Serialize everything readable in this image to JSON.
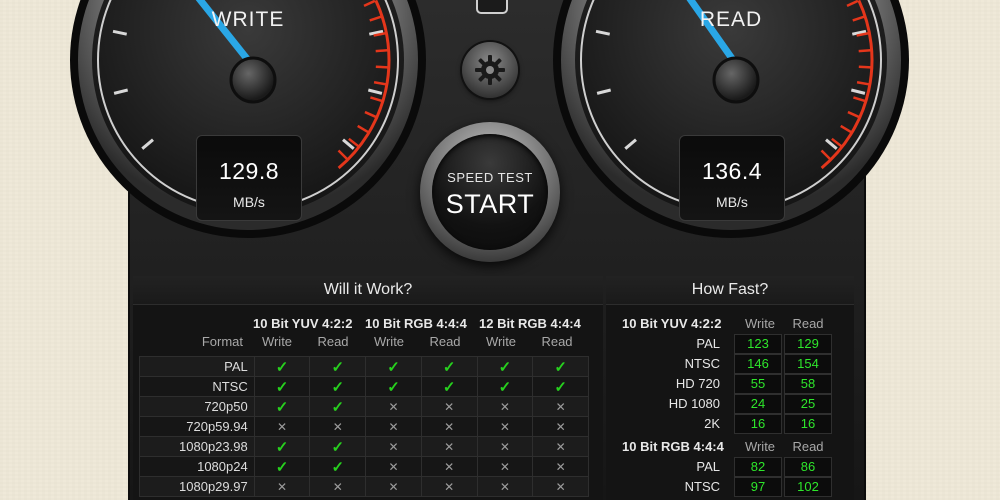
{
  "write_gauge": {
    "label": "WRITE",
    "value": "129.8",
    "unit": "MB/s"
  },
  "read_gauge": {
    "label": "READ",
    "value": "136.4",
    "unit": "MB/s"
  },
  "start_button": {
    "sub_label": "SPEED TEST",
    "label": "START"
  },
  "will_it_work": {
    "title": "Will it Work?",
    "format_header": "Format",
    "groups": [
      {
        "name": "10 Bit YUV 4:2:2",
        "write": "Write",
        "read": "Read"
      },
      {
        "name": "10 Bit RGB 4:4:4",
        "write": "Write",
        "read": "Read"
      },
      {
        "name": "12 Bit RGB 4:4:4",
        "write": "Write",
        "read": "Read"
      }
    ],
    "rows": [
      {
        "format": "PAL",
        "cells": [
          "✓",
          "✓",
          "✓",
          "✓",
          "✓",
          "✓"
        ]
      },
      {
        "format": "NTSC",
        "cells": [
          "✓",
          "✓",
          "✓",
          "✓",
          "✓",
          "✓"
        ]
      },
      {
        "format": "720p50",
        "cells": [
          "✓",
          "✓",
          "✕",
          "✕",
          "✕",
          "✕"
        ]
      },
      {
        "format": "720p59.94",
        "cells": [
          "✕",
          "✕",
          "✕",
          "✕",
          "✕",
          "✕"
        ]
      },
      {
        "format": "1080p23.98",
        "cells": [
          "✓",
          "✓",
          "✕",
          "✕",
          "✕",
          "✕"
        ]
      },
      {
        "format": "1080p24",
        "cells": [
          "✓",
          "✓",
          "✕",
          "✕",
          "✕",
          "✕"
        ]
      },
      {
        "format": "1080p29.97",
        "cells": [
          "✕",
          "✕",
          "✕",
          "✕",
          "✕",
          "✕"
        ]
      }
    ]
  },
  "how_fast": {
    "title": "How Fast?",
    "sections": [
      {
        "name": "10 Bit YUV 4:2:2",
        "write": "Write",
        "read": "Read",
        "rows": [
          {
            "label": "PAL",
            "write": "123",
            "read": "129"
          },
          {
            "label": "NTSC",
            "write": "146",
            "read": "154"
          },
          {
            "label": "HD 720",
            "write": "55",
            "read": "58"
          },
          {
            "label": "HD 1080",
            "write": "24",
            "read": "25"
          },
          {
            "label": "2K",
            "write": "16",
            "read": "16"
          }
        ]
      },
      {
        "name": "10 Bit RGB 4:4:4",
        "write": "Write",
        "read": "Read",
        "rows": [
          {
            "label": "PAL",
            "write": "82",
            "read": "86"
          },
          {
            "label": "NTSC",
            "write": "97",
            "read": "102"
          }
        ]
      }
    ]
  },
  "icons": {
    "settings": "gear-icon",
    "check": "check-icon",
    "cross": "cross-icon"
  },
  "colors": {
    "check": "#27d01e",
    "value_text": "#2ee62b",
    "needle": "#2aa7e6",
    "redline": "#e4361b"
  }
}
